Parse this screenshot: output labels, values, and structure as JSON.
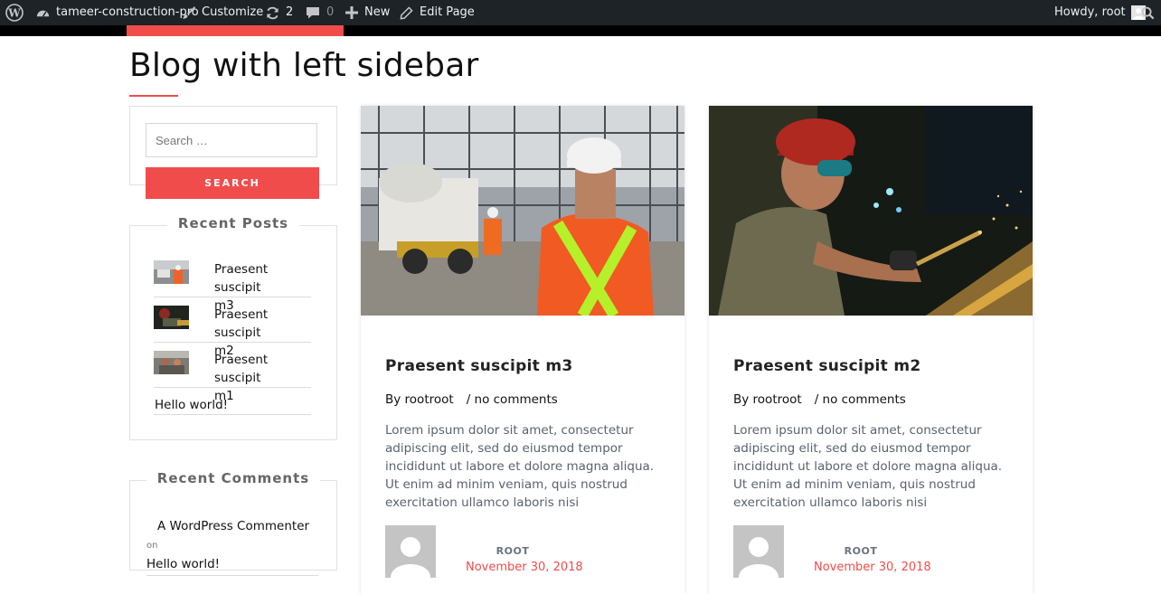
{
  "admin_bar": {
    "site_name": "tameer-construction-pro",
    "customize": "Customize",
    "updates_count": "2",
    "comments_count": "0",
    "new": "New",
    "edit_page": "Edit Page",
    "howdy": "Howdy, root"
  },
  "page": {
    "title": "Blog with left sidebar"
  },
  "sidebar": {
    "search": {
      "placeholder": "Search …",
      "button": "SEARCH"
    },
    "recent_posts": {
      "title": "Recent Posts",
      "items": [
        {
          "line1": "Praesent suscipit",
          "line2": "m3"
        },
        {
          "line1": "Praesent suscipit",
          "line2": "m2"
        },
        {
          "line1": "Praesent suscipit",
          "line2": "m1"
        },
        {
          "line1": "Hello world!"
        }
      ]
    },
    "recent_comments": {
      "title": "Recent Comments",
      "author": "A WordPress Commenter",
      "on": "on",
      "post": "Hello world!"
    }
  },
  "posts": [
    {
      "title": "Praesent suscipit m3",
      "by": "By rootroot",
      "comments": "/ no comments",
      "excerpt": "Lorem ipsum dolor sit amet, consectetur adipiscing elit, sed do eiusmod tempor incididunt ut labore et dolore magna aliqua. Ut enim ad minim veniam, quis nostrud exercitation ullamco laboris nisi",
      "author": "ROOT",
      "date": "November 30, 2018"
    },
    {
      "title": "Praesent suscipit m2",
      "by": "By rootroot",
      "comments": "/ no comments",
      "excerpt": "Lorem ipsum dolor sit amet, consectetur adipiscing elit, sed do eiusmod tempor incididunt ut labore et dolore magna aliqua. Ut enim ad minim veniam, quis nostrud exercitation ullamco laboris nisi",
      "author": "ROOT",
      "date": "November 30, 2018"
    }
  ],
  "colors": {
    "accent": "#f14c4c",
    "admin_bar_bg": "#1d2327"
  }
}
